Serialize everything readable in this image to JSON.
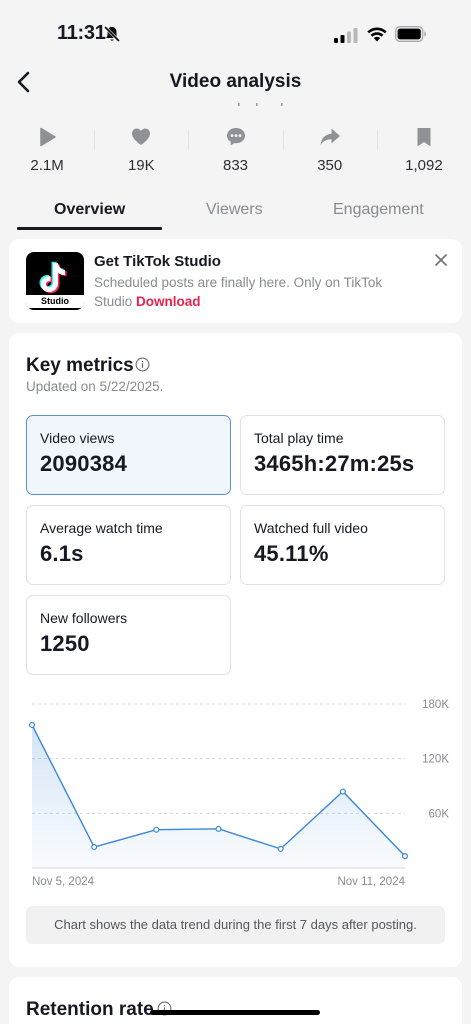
{
  "status_bar": {
    "time": "11:31"
  },
  "header": {
    "title": "Video analysis"
  },
  "stats": [
    {
      "icon": "play-icon",
      "value": "2.1M"
    },
    {
      "icon": "heart-icon",
      "value": "19K"
    },
    {
      "icon": "comment-icon",
      "value": "833"
    },
    {
      "icon": "share-icon",
      "value": "350"
    },
    {
      "icon": "bookmark-icon",
      "value": "1,092"
    }
  ],
  "tabs": [
    {
      "label": "Overview",
      "active": true
    },
    {
      "label": "Viewers",
      "active": false
    },
    {
      "label": "Engagement",
      "active": false
    }
  ],
  "promo": {
    "logo_label": "Studio",
    "title": "Get TikTok Studio",
    "description": "Scheduled posts are finally here. Only on TikTok Studio",
    "link": "Download"
  },
  "metrics": {
    "title": "Key metrics",
    "updated": "Updated on 5/22/2025.",
    "cards": [
      {
        "label": "Video views",
        "value": "2090384",
        "selected": true
      },
      {
        "label": "Total play time",
        "value": "3465h:27m:25s",
        "selected": false
      },
      {
        "label": "Average watch time",
        "value": "6.1s",
        "selected": false
      },
      {
        "label": "Watched full video",
        "value": "45.11%",
        "selected": false
      },
      {
        "label": "New followers",
        "value": "1250",
        "selected": false
      }
    ],
    "chart_note": "Chart shows the data trend during the first 7 days after posting."
  },
  "chart_data": {
    "type": "area",
    "x": [
      "Nov 5, 2024",
      "Nov 6, 2024",
      "Nov 7, 2024",
      "Nov 8, 2024",
      "Nov 9, 2024",
      "Nov 10, 2024",
      "Nov 11, 2024"
    ],
    "values": [
      157000,
      23000,
      42000,
      43000,
      21000,
      84000,
      13000
    ],
    "x_tick_labels": [
      "Nov 5, 2024",
      "Nov 11, 2024"
    ],
    "y_tick_labels": [
      "180K",
      "120K",
      "60K"
    ],
    "y_ticks": [
      180000,
      120000,
      60000
    ],
    "ylim": [
      0,
      180000
    ],
    "grid": true,
    "line_color": "#3a87d6"
  },
  "retention": {
    "title": "Retention rate"
  }
}
